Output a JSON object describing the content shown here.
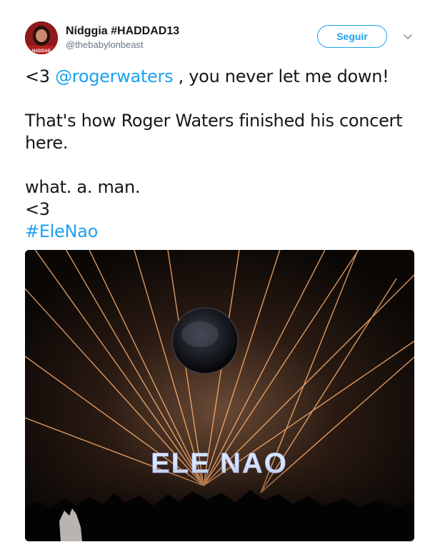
{
  "user": {
    "display_name": "Nídggia #HADDAD13",
    "handle": "@thebabylonbeast",
    "avatar_caption": "HADDAD"
  },
  "follow_button": {
    "label": "Seguir"
  },
  "tweet": {
    "line1_prefix": "<3 ",
    "mention": "@rogerwaters",
    "line1_suffix": " , you never let me down!",
    "line2": "That's how Roger Waters finished his concert here.",
    "line3": "what. a. man.",
    "line4": "<3",
    "hashtag": "#EleNao"
  },
  "media": {
    "sign_text": "ELE NAO",
    "colors": {
      "laser": "#ffb070",
      "sign": "#d8e6ff",
      "background": "#0a0705"
    }
  },
  "icons": {
    "more": "chevron-down-icon"
  },
  "colors": {
    "accent": "#1da1f2",
    "text": "#14171a",
    "muted": "#657786"
  }
}
